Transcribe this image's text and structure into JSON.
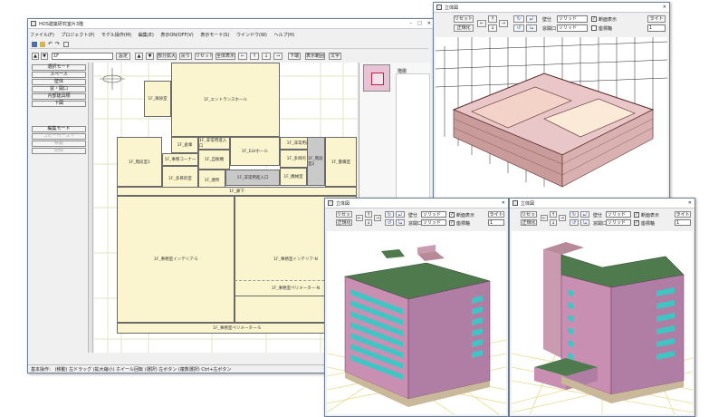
{
  "main_window": {
    "title": "HOS建築研究室片3階",
    "menu": [
      "ファイル(F)",
      "プロジェクト(P)",
      "モデル操作(M)",
      "編集(E)",
      "表示ON/OFF(V)",
      "表示モード(S)",
      "ウインドウ(W)",
      "ヘルプ(H)"
    ],
    "floor_select": "1F",
    "toolbar_buttons": [
      "設定",
      "▲",
      "▼",
      "部分拡大",
      "戻り",
      "リセット",
      "全体表示",
      "←",
      "↑",
      "↓",
      "→",
      "下端",
      "表示範囲",
      "文字"
    ],
    "side_buttons": [
      "選択モード",
      "スペース",
      "壁体",
      "窓・開口",
      "内部建具類",
      "下図"
    ],
    "side_buttons2": [
      "編集モード",
      "コピーペースト",
      "移動",
      "削除"
    ],
    "status_bar": "基本操作： (移動) 左ドラッグ (拡大縮小) ホイール回転 (選択) 左ボタン (複数選択) Ctrl+左ボタン",
    "side_panel_label": "階層",
    "rooms": [
      "1F_風除室",
      "1F_エントランスホール",
      "1F_倉庫",
      "1F_非常用進入口",
      "1F_ELVホール",
      "1F_非常用進入口",
      "1F_階段室1",
      "1F_事務コーナー",
      "1F_自販機",
      "1F_非常用進入口",
      "1F_多目的室",
      "1F_便所",
      "1F_多目的トイレ",
      "1F_機械室",
      "1F_階段室2",
      "1F_警備室",
      "1F_事務室インテリア-S",
      "1F_事務室インテリア-N",
      "1F_事務室ペリメーター-N",
      "1F_事務室ペリメーター-S",
      "1F_廊下"
    ]
  },
  "view3d": {
    "title": "立体図",
    "reset_label": "リセット",
    "normalize_label": "正規化",
    "arrows": [
      "←",
      "↑",
      "↓",
      "→"
    ],
    "wall_label": "壁仕",
    "wall_value": "ソリッド",
    "window_label": "窓開口",
    "window_value": "ソリッド",
    "section_label": "断面表示",
    "axis_label": "座標軸",
    "light_label": "ライト",
    "light_value": "1"
  }
}
